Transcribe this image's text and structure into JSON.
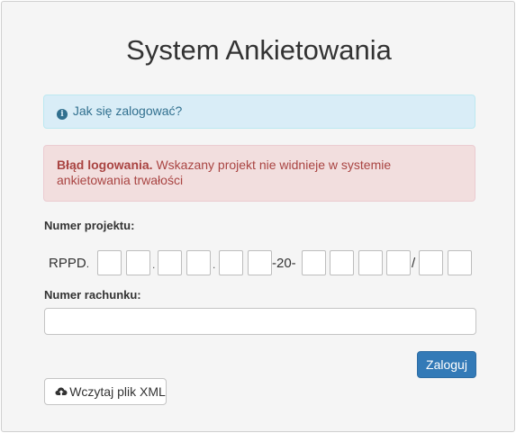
{
  "page": {
    "title": "System Ankietowania"
  },
  "info_alert": {
    "icon": "info-circle-icon",
    "text": "Jak się zalogować?"
  },
  "error_alert": {
    "title": "Błąd logowania.",
    "message": " Wskazany projekt nie widnieje w systemie ankietowania trwałości"
  },
  "project": {
    "label": "Numer projektu:",
    "prefix": "RPPD",
    "dot": ".",
    "middle": "-20-",
    "slash": "/",
    "segments": [
      {
        "value": ""
      },
      {
        "value": ""
      },
      {
        "value": ""
      },
      {
        "value": ""
      },
      {
        "value": ""
      },
      {
        "value": ""
      },
      {
        "value": ""
      },
      {
        "value": ""
      },
      {
        "value": ""
      },
      {
        "value": ""
      },
      {
        "value": ""
      },
      {
        "value": ""
      }
    ]
  },
  "account": {
    "label": "Numer rachunku:",
    "value": ""
  },
  "buttons": {
    "login": "Zaloguj",
    "load_xml": "Wczytaj plik XML",
    "load_xml_icon": "cloud-upload-icon"
  },
  "colors": {
    "primary": "#337ab7",
    "info_bg": "#d9edf7",
    "info_text": "#31708f",
    "danger_bg": "#f2dede",
    "danger_text": "#a94442",
    "panel_bg": "#f5f5f5"
  }
}
